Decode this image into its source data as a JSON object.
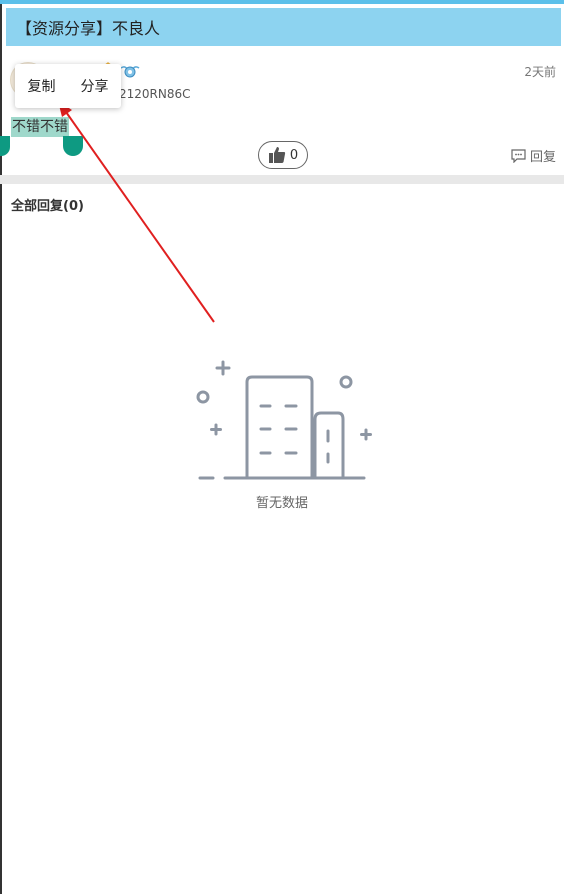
{
  "header": {
    "title": "【资源分享】不良人"
  },
  "post": {
    "user_id": "2120RN86C",
    "time": "2天前",
    "content": "不错不错",
    "like_count": "0",
    "reply_label": "回复",
    "badges": [
      "flame-badge-icon",
      "blue-wing-badge-icon"
    ]
  },
  "context_menu": {
    "copy": "复制",
    "share": "分享"
  },
  "replies": {
    "header": "全部回复(0)"
  },
  "empty_state": {
    "text": "暂无数据",
    "icon": "empty-building-icon"
  },
  "colors": {
    "header_bg": "#8dd3f0",
    "selection_bg": "#9fd8cb",
    "selection_handle": "#0e9a82",
    "annotation_arrow": "#e02020",
    "illustration": "#8d96a3"
  }
}
